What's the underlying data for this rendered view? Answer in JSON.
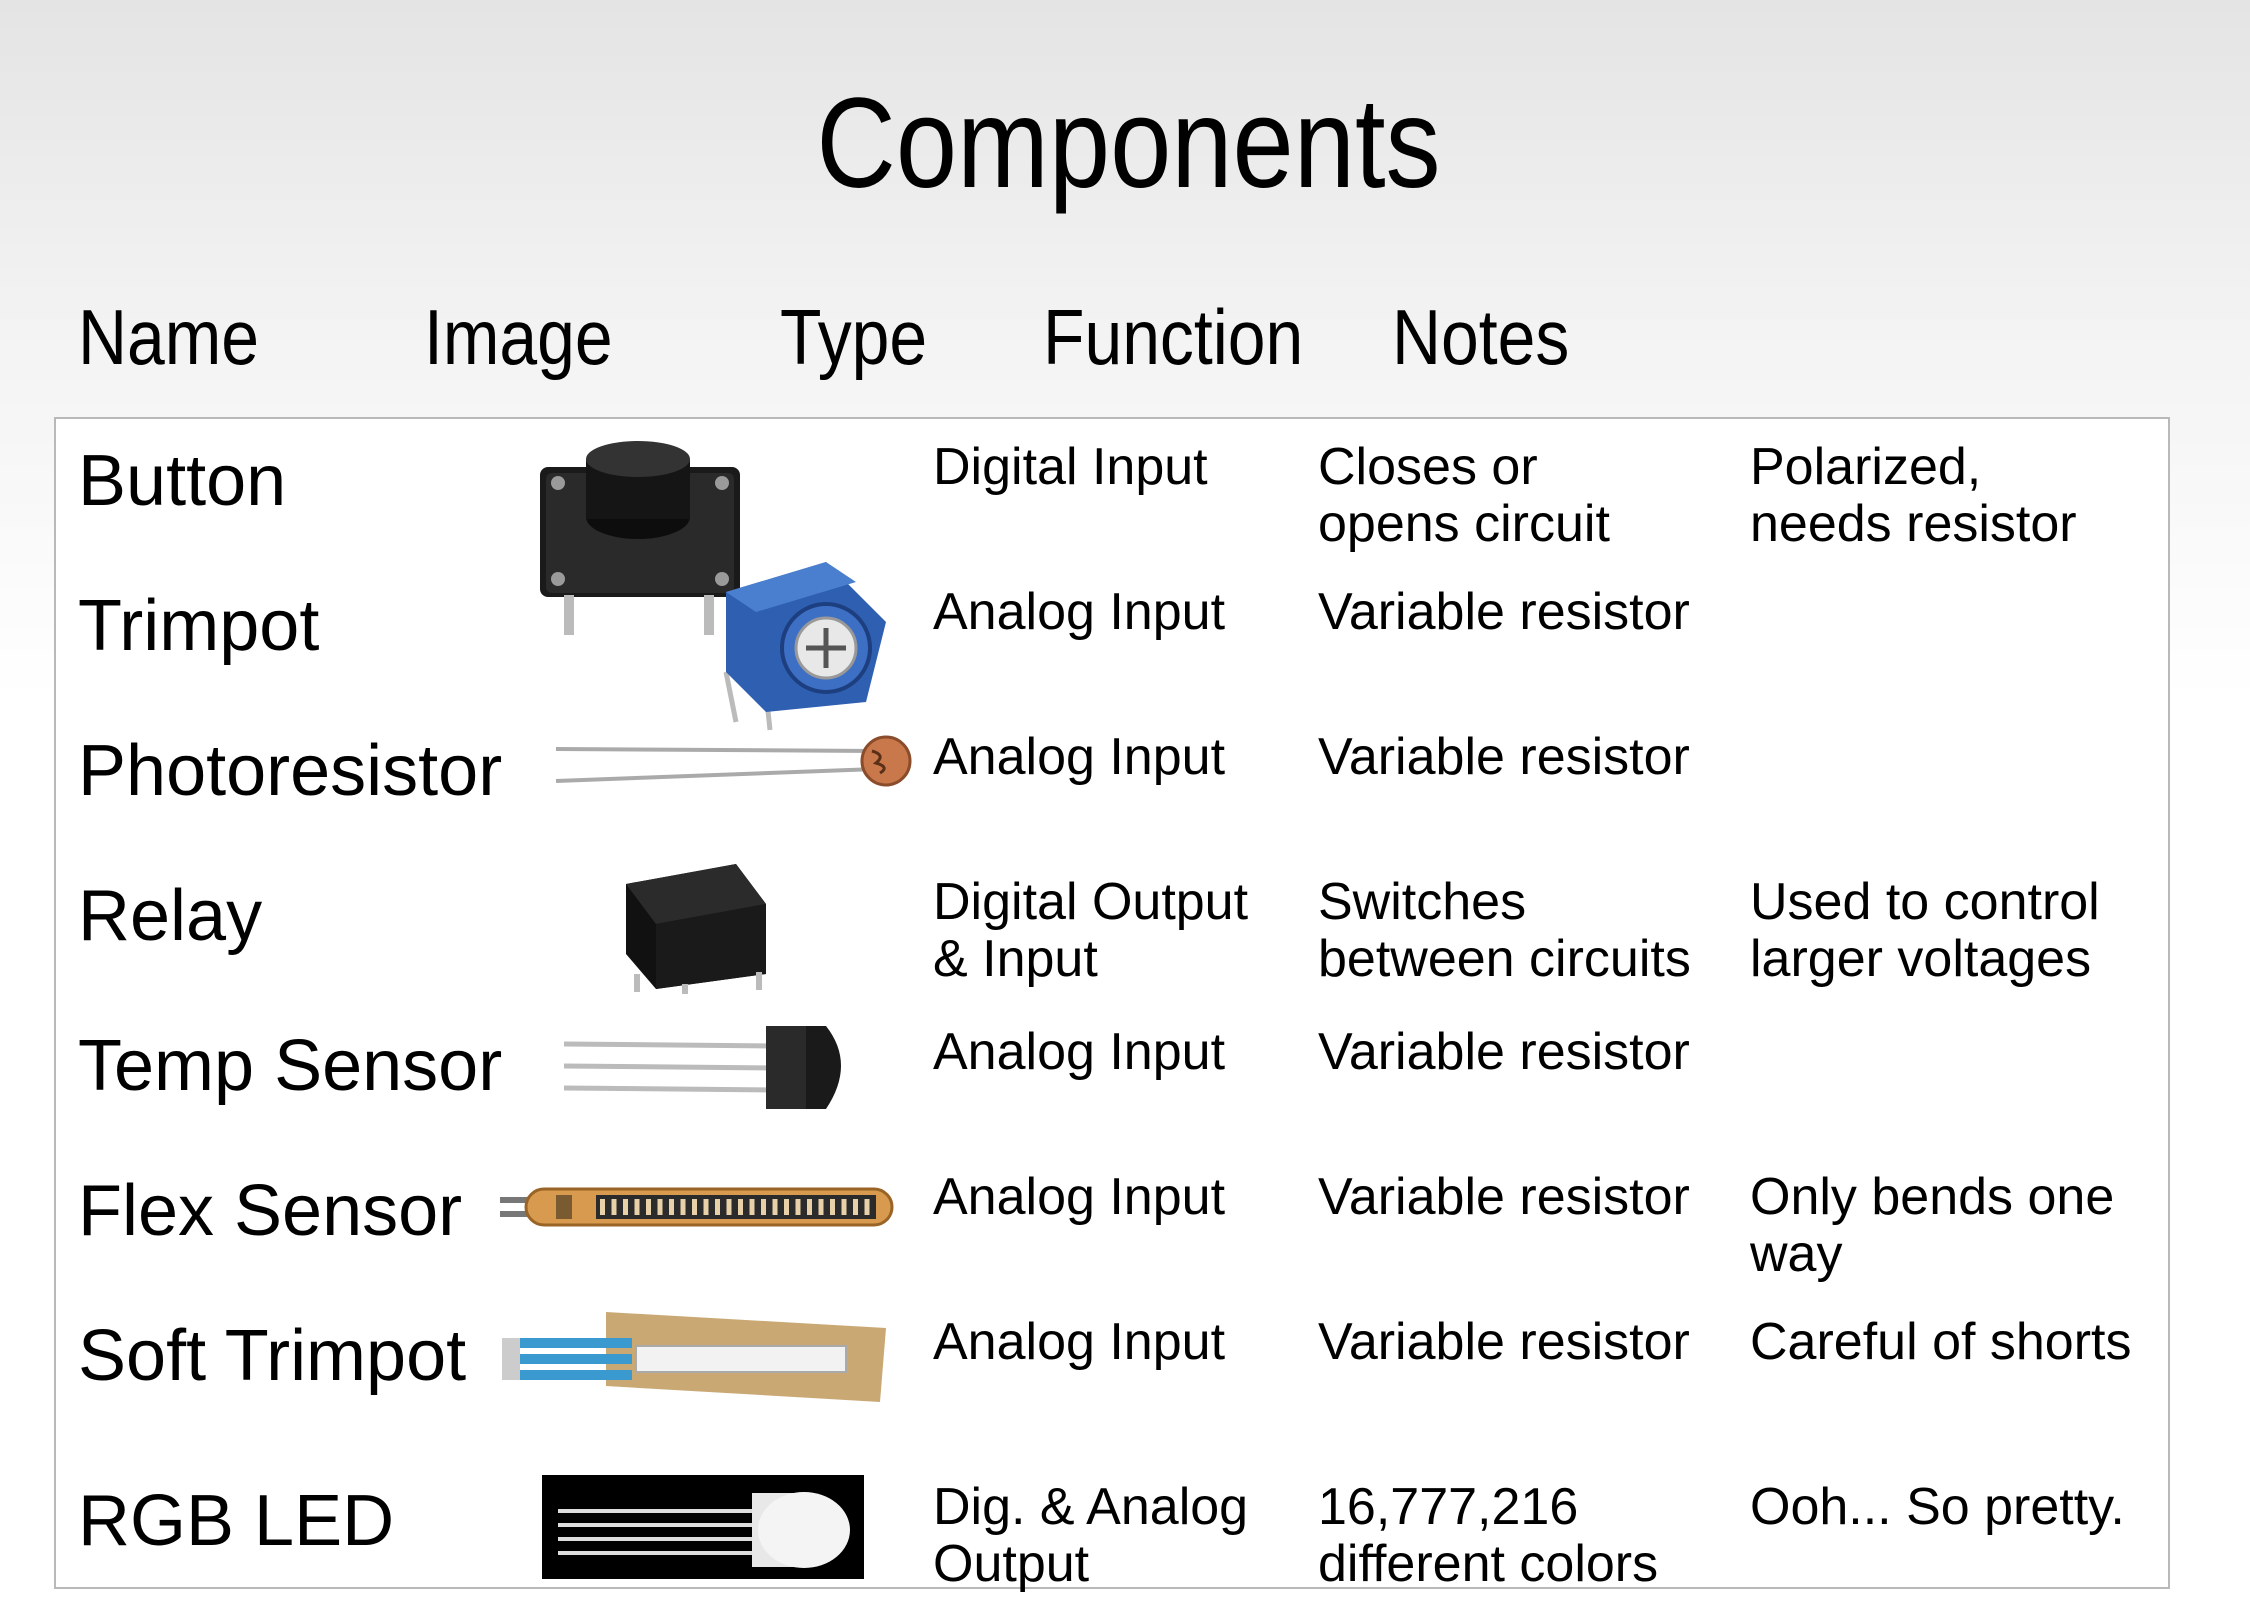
{
  "title": "Components",
  "headers": {
    "name": "Name",
    "image": "Image",
    "type": "Type",
    "function": "Function",
    "notes": "Notes"
  },
  "rows": [
    {
      "name": "Button",
      "type": "Digital Input",
      "function": "Closes or\nopens circuit",
      "notes": "Polarized,\nneeds resistor",
      "image": "pushbutton-image"
    },
    {
      "name": "Trimpot",
      "type": "Analog Input",
      "function": "Variable resistor",
      "notes": "",
      "image": "trimpot-image"
    },
    {
      "name": "Photoresistor",
      "type": "Analog Input",
      "function": "Variable resistor",
      "notes": "",
      "image": "photoresistor-image"
    },
    {
      "name": "Relay",
      "type": "Digital Output\n& Input",
      "function": "Switches\nbetween circuits",
      "notes": "Used to control\nlarger voltages",
      "image": "relay-image"
    },
    {
      "name": "Temp Sensor",
      "type": "Analog Input",
      "function": "Variable resistor",
      "notes": "",
      "image": "temp-sensor-image"
    },
    {
      "name": "Flex Sensor",
      "type": "Analog Input",
      "function": "Variable resistor",
      "notes": "Only bends one\nway",
      "image": "flex-sensor-image"
    },
    {
      "name": "Soft Trimpot",
      "type": "Analog Input",
      "function": "Variable resistor",
      "notes": "Careful of shorts",
      "image": "soft-trimpot-image"
    },
    {
      "name": "RGB LED",
      "type": "Dig. & Analog\nOutput",
      "function": "16,777,216\ndifferent colors",
      "notes": "Ooh... So pretty.",
      "image": "rgb-led-image"
    }
  ]
}
